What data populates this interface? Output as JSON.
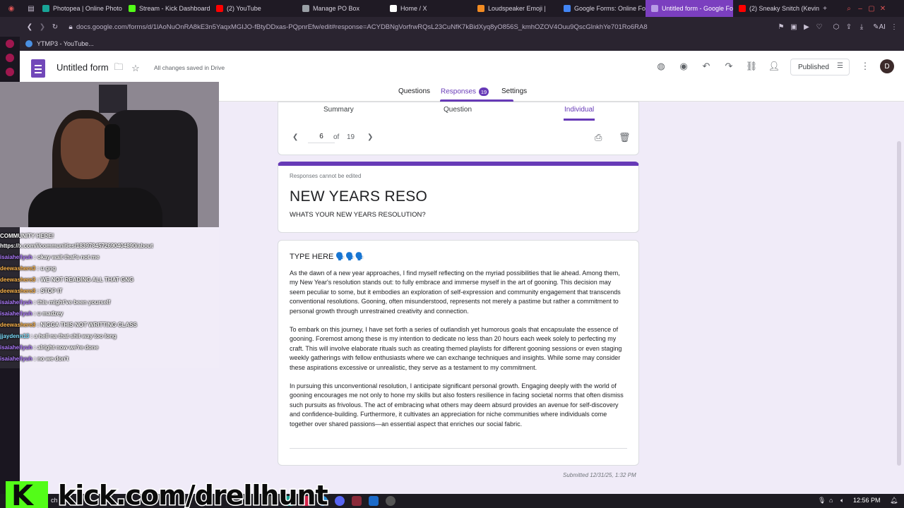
{
  "browser": {
    "tabs": [
      {
        "label": "Photopea | Online Photo",
        "color": "#18a497"
      },
      {
        "label": "Stream - Kick Dashboard",
        "color": "#53fc18"
      },
      {
        "label": "(2) YouTube",
        "color": "#ff0000"
      },
      {
        "label": "Manage PO Box",
        "color": "#9aa0a6"
      },
      {
        "label": "Home / X",
        "color": "#ffffff"
      },
      {
        "label": "Loudspeaker Emoji |",
        "color": "#f28b22"
      },
      {
        "label": "Google Forms: Online Fo",
        "color": "#4285f4"
      },
      {
        "label": "Untitled form - Google Fo",
        "color": "#7248b9"
      },
      {
        "label": "(2) Sneaky Snitch (Kevin",
        "color": "#ff0000"
      }
    ],
    "url": "docs.google.com/forms/d/1lAoNuOnRA8kE3n5YaqxMGIJO-fBtyDDxas-PQpnrEfw/edit#response=ACYDBNgVorfrwRQsL23CuNfK7kBidXyq8yO856S_kmhOZOV4Ouu9QscGlnkhYe701Ro6RA8",
    "bookmark": "YTMP3 - YouTube..."
  },
  "form_header": {
    "title": "Untitled form",
    "saved_status": "All changes saved in Drive",
    "published_label": "Published",
    "avatar_initial": "D",
    "tabs": {
      "questions": "Questions",
      "responses": "Responses",
      "responses_count": "19",
      "settings": "Settings"
    }
  },
  "responses": {
    "subtabs": {
      "summary": "Summary",
      "question": "Question",
      "individual": "Individual"
    },
    "pager": {
      "current": "6",
      "of": "of",
      "total": "19"
    }
  },
  "form": {
    "readonly_notice": "Responses cannot be edited",
    "title": "NEW YEARS RESO",
    "description": "WHATS YOUR NEW YEARS RESOLUTION?",
    "question": "TYPE HERE 🗣️🗣️🗣️",
    "answer_paragraphs": [
      "As the dawn of a new year approaches, I find myself reflecting on the myriad possibilities that lie ahead. Among them, my New Year's resolution stands out: to fully embrace and immerse myself in the art of gooning. This decision may seem peculiar to some, but it embodies an exploration of self-expression and community engagement that transcends conventional resolutions. Gooning, often misunderstood, represents not merely a pastime but rather a commitment to personal growth through unrestrained creativity and connection.",
      "To embark on this journey, I have set forth a series of outlandish yet humorous goals that encapsulate the essence of gooning. Foremost among these is my intention to dedicate no less than 20 hours each week solely to perfecting my craft. This will involve elaborate rituals such as creating themed playlists for different gooning sessions or even staging weekly gatherings with fellow enthusiasts where we can exchange techniques and insights. While some may consider these aspirations excessive or unrealistic, they serve as a testament to my commitment.",
      "In pursuing this unconventional resolution, I anticipate significant personal growth. Engaging deeply with the world of gooning encourages me not only to hone my skills but also fosters resilience in facing societal norms that often dismiss such pursuits as frivolous. The act of embracing what others may deem absurd provides an avenue for self-discovery and confidence-building. Furthermore, it cultivates an appreciation for niche communities where individuals come together over shared passions—an essential aspect that enriches our social fabric."
    ],
    "submitted": "Submitted 12/31/25, 1:32 PM"
  },
  "stream": {
    "chat_header": [
      "COMMUNITY HERE!",
      "https://x.com/i/communities/1839784572690404890/about"
    ],
    "chat": [
      {
        "user": "isaiahellyuh",
        "msg": "okay wait that's not me"
      },
      {
        "user": "deewashere3",
        "msg": "u gng"
      },
      {
        "user": "deewashere3",
        "msg": "WE NOT READING ALL THAT GNG"
      },
      {
        "user": "deewashere3",
        "msg": "STOP IT"
      },
      {
        "user": "isaiahellyuh",
        "msg": "this might've been yourself"
      },
      {
        "user": "isaiahellyuh",
        "msg": "u madzey"
      },
      {
        "user": "deewashere3",
        "msg": "NIGGA THIS NOT WRITTING CLASS"
      },
      {
        "user": "jjaydenn13",
        "msg": "a hell na that shit way too long"
      },
      {
        "user": "isaiahellyuh",
        "msg": "alright now we're done"
      },
      {
        "user": "isaiahellyuh",
        "msg": "no we don't"
      }
    ],
    "kick_text": "kick.com/drellhunt"
  },
  "taskbar": {
    "time": "12:56 PM",
    "search_stub": "ch"
  }
}
